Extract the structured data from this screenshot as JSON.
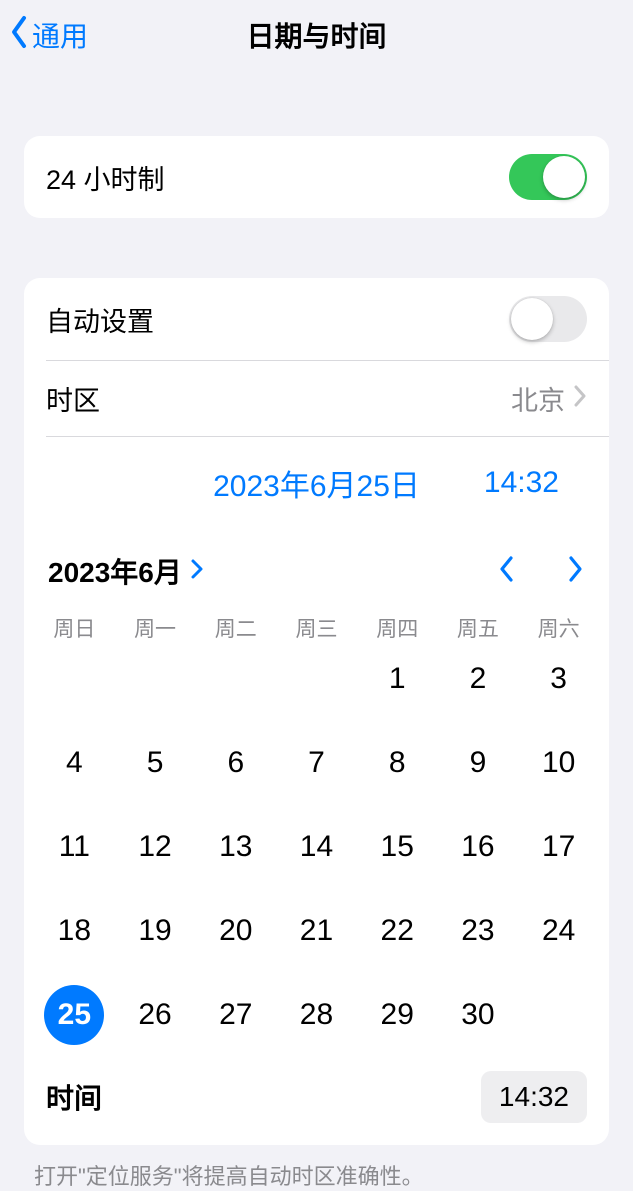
{
  "nav": {
    "back_label": "通用",
    "title": "日期与时间"
  },
  "hour24": {
    "label": "24 小时制",
    "on": true
  },
  "auto_set": {
    "label": "自动设置",
    "on": false
  },
  "timezone": {
    "label": "时区",
    "value": "北京"
  },
  "summary": {
    "date": "2023年6月25日",
    "time": "14:32"
  },
  "calendar": {
    "month_label": "2023年6月",
    "weekdays": [
      "周日",
      "周一",
      "周二",
      "周三",
      "周四",
      "周五",
      "周六"
    ],
    "leading_blanks": 4,
    "days_in_month": 30,
    "selected_day": 25
  },
  "time_row": {
    "label": "时间",
    "value": "14:32"
  },
  "footnote": "打开\"定位服务\"将提高自动时区准确性。"
}
